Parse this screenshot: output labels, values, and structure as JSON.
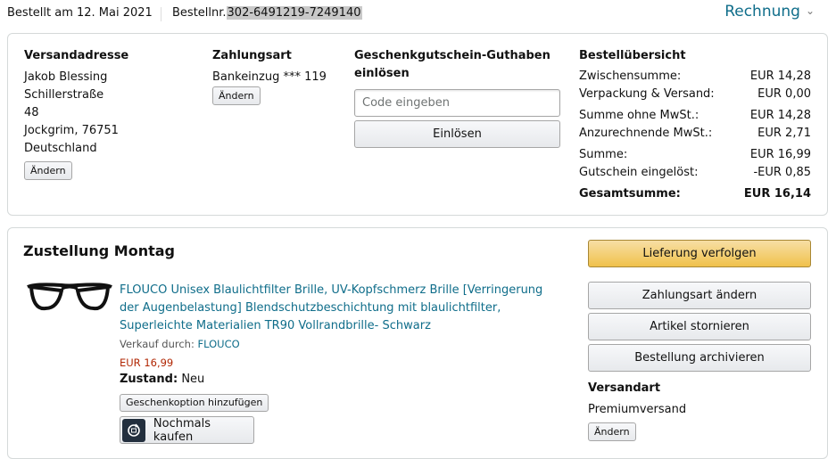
{
  "header": {
    "ordered_label": "Bestellt am 12. Mai 2021",
    "order_number_label": "Bestellnr.",
    "order_number": "302-6491219-7249140",
    "invoice_label": "Rechnung",
    "invoice_chevron": "chevron-down-icon"
  },
  "summary_box": {
    "shipping": {
      "heading": "Versandadresse",
      "lines": [
        "Jakob Blessing",
        "Schillerstraße",
        "48",
        "Jockgrim, 76751",
        "Deutschland"
      ],
      "change_label": "Ändern"
    },
    "payment": {
      "heading": "Zahlungsart",
      "method": "Bankeinzug *** 119",
      "change_label": "Ändern"
    },
    "gift_card": {
      "heading_line1": "Geschenkgutschein-Guthaben",
      "heading_line2": "einlösen",
      "placeholder": "Code eingeben",
      "redeem_label": "Einlösen"
    },
    "order_overview": {
      "heading": "Bestellübersicht",
      "rows": [
        {
          "label": "Zwischensumme:",
          "value": "EUR 14,28"
        },
        {
          "label": "Verpackung & Versand:",
          "value": "EUR 0,00"
        },
        {
          "label": "Summe ohne MwSt.:",
          "value": "EUR 14,28"
        },
        {
          "label": "Anzurechnende MwSt.:",
          "value": "EUR 2,71"
        },
        {
          "label": "Summe:",
          "value": "EUR 16,99"
        },
        {
          "label": "Gutschein eingelöst:",
          "value": "-EUR 0,85"
        }
      ],
      "total": {
        "label": "Gesamtsumme:",
        "value": "EUR 16,14"
      }
    }
  },
  "delivery": {
    "title": "Zustellung Montag",
    "item": {
      "image": "glasses-image",
      "title": "FLOUCO Unisex Blaulichtfilter Brille, UV-Kopfschmerz Brille [Verringerung der Augenbelastung] Blendschutzbeschichtung mit blaulichtfilter, Superleichte Materialien TR90 Vollrandbrille- Schwarz",
      "sold_by_label": "Verkauf durch:",
      "seller": "FLOUCO",
      "price": "EUR 16,99",
      "condition_label": "Zustand:",
      "condition_value": "Neu",
      "gift_option_label": "Geschenkoption hinzufügen",
      "buy_again_label": "Nochmals kaufen",
      "buy_again_icon": "buy-again-icon"
    },
    "actions": {
      "track": "Lieferung verfolgen",
      "change_payment": "Zahlungsart ändern",
      "cancel": "Artikel stornieren",
      "archive": "Bestellung archivieren"
    },
    "shipping_method": {
      "heading": "Versandart",
      "value": "Premiumversand",
      "change_label": "Ändern"
    }
  },
  "colors": {
    "link": "#0f6d8a",
    "price": "#b12704",
    "primary_button": "#f0c14b",
    "border": "#d5d9d9"
  }
}
